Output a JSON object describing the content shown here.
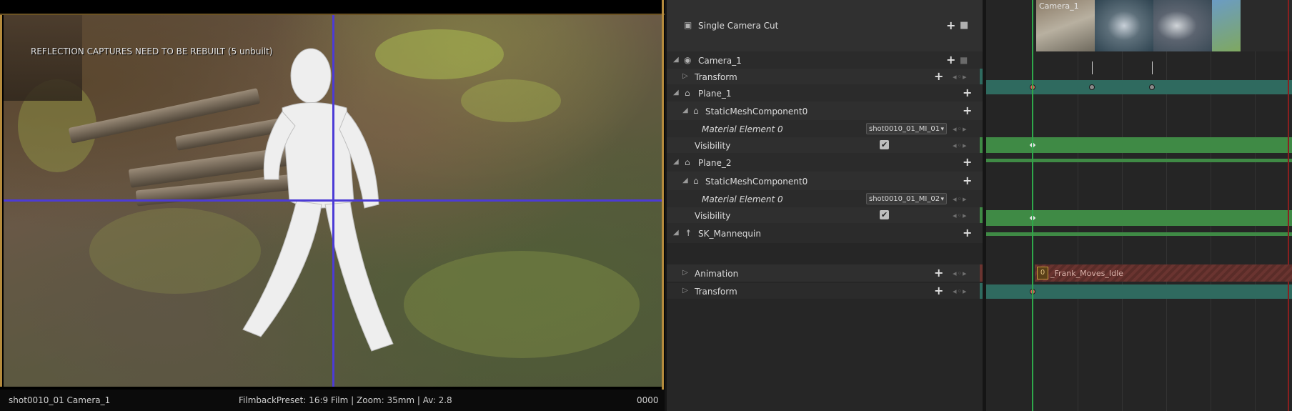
{
  "viewport": {
    "warning": "REFLECTION CAPTURES NEED TO BE REBUILT (5 unbuilt)",
    "shot_camera": "shot0010_01  Camera_1",
    "filmback": "FilmbackPreset: 16:9 Film | Zoom: 35mm | Av: 2.8",
    "frame": "0000"
  },
  "outliner": {
    "camera_cut": {
      "label": "Single Camera Cut",
      "icon": "camera-cut-icon"
    },
    "camera": {
      "label": "Camera_1",
      "icon": "camera-actor-icon"
    },
    "camera_transform": {
      "label": "Transform"
    },
    "plane1": {
      "label": "Plane_1",
      "icon": "actor-icon"
    },
    "plane1_component": {
      "label": "StaticMeshComponent0",
      "icon": "static-mesh-icon"
    },
    "plane1_material": {
      "label": "Material Element 0",
      "value": "shot0010_01_MI_01"
    },
    "plane1_visibility": {
      "label": "Visibility",
      "checked": true
    },
    "plane2": {
      "label": "Plane_2",
      "icon": "actor-icon"
    },
    "plane2_component": {
      "label": "StaticMeshComponent0",
      "icon": "static-mesh-icon"
    },
    "plane2_material": {
      "label": "Material Element 0",
      "value": "shot0010_01_MI_02"
    },
    "plane2_visibility": {
      "label": "Visibility",
      "checked": true
    },
    "mannequin": {
      "label": "SK_Mannequin",
      "icon": "skeletal-mesh-icon"
    },
    "animation": {
      "label": "Animation"
    },
    "mannequin_transform": {
      "label": "Transform"
    }
  },
  "timeline": {
    "camera_label": "Camera_1",
    "anim_clip_label": "_Frank_Moves_Idle",
    "anim_badge": "0"
  },
  "colors": {
    "playhead": "#2ea84a",
    "transform_track": "#2f6a5f",
    "material_track": "#3f8a45",
    "anim_track": "#6a3430",
    "guide_lines": "#4c3bd6"
  }
}
